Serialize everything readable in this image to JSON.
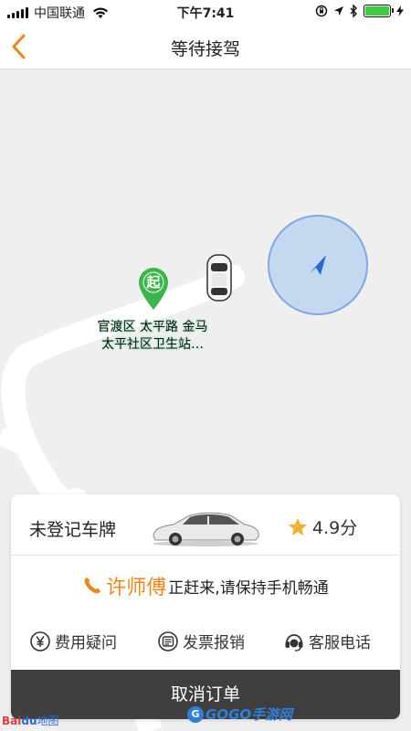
{
  "status_bar": {
    "carrier": "中国联通",
    "time": "下午7:41",
    "battery_color": "#3ecb3e"
  },
  "nav": {
    "title": "等待接驾",
    "back_icon": "chevron-left-icon",
    "accent_color": "#f08519"
  },
  "map": {
    "start_pin_glyph": "起",
    "start_pin_color": "#3cb54a",
    "start_label": "官渡区 太平路 金马\n太平社区卫生站…",
    "location_icon": "location-arrow-icon"
  },
  "card": {
    "plate": "未登记车牌",
    "rating": "4.9分",
    "driver_name": "许师傅",
    "driver_message": "正赶来,请保持手机畅通",
    "actions": [
      {
        "label": "费用疑问",
        "icon": "yen-icon"
      },
      {
        "label": "发票报销",
        "icon": "invoice-icon"
      },
      {
        "label": "客服电话",
        "icon": "headset-icon"
      }
    ],
    "cancel_label": "取消订单"
  },
  "footer": {
    "map_logo_bai": "Bai",
    "map_logo_du": "du",
    "map_logo_suffix": "地图",
    "watermark_icon": "G",
    "watermark": "GOGO手游网"
  }
}
